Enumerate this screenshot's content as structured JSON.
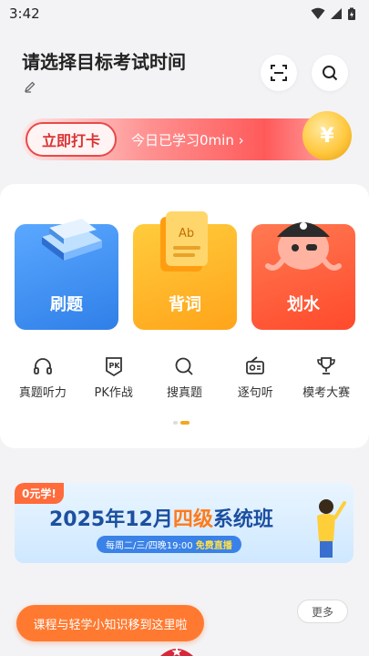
{
  "status_bar": {
    "time": "3:42"
  },
  "header": {
    "title": "请选择目标考试时间"
  },
  "checkin": {
    "button_label": "立即打卡",
    "study_text": "今日已学习0min ›"
  },
  "big_cards": [
    {
      "label": "刷题",
      "color": "#3b8ff0"
    },
    {
      "label": "背词",
      "color": "#ffb21f"
    },
    {
      "label": "划水",
      "color": "#ff5a3c"
    }
  ],
  "quick_actions": [
    {
      "label": "真题听力",
      "icon": "headphones-icon"
    },
    {
      "label": "PK作战",
      "icon": "pk-badge-icon"
    },
    {
      "label": "搜真题",
      "icon": "search-icon"
    },
    {
      "label": "逐句听",
      "icon": "radio-icon"
    },
    {
      "label": "模考大赛",
      "icon": "trophy-icon"
    }
  ],
  "promo": {
    "tag": "0元学!",
    "title_prefix": "2025年12月",
    "title_highlight": "四级",
    "title_suffix": "系统班",
    "schedule": "每周二/三/四晚19:00",
    "live": "免费直播"
  },
  "more_label": "更多",
  "toast": "课程与轻学小知识移到这里啦"
}
